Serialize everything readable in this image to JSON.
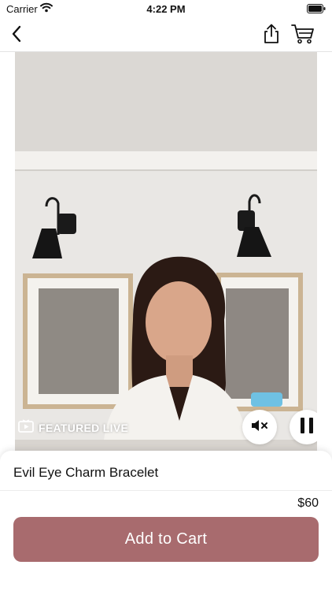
{
  "status_bar": {
    "carrier": "Carrier",
    "time": "4:22 PM"
  },
  "nav": {
    "back_icon": "chevron-left-icon",
    "share_icon": "share-icon",
    "cart_icon": "cart-icon"
  },
  "video": {
    "featured_label": "FEATURED LIVE",
    "featured_icon": "tv-play-icon",
    "mute_icon": "speaker-muted-icon",
    "pause_icon": "pause-icon"
  },
  "product": {
    "title": "Evil Eye Charm Bracelet",
    "price": "$60",
    "add_to_cart_label": "Add to Cart"
  },
  "colors": {
    "accent": "#a86b6e",
    "sheet": "#ffffff"
  }
}
